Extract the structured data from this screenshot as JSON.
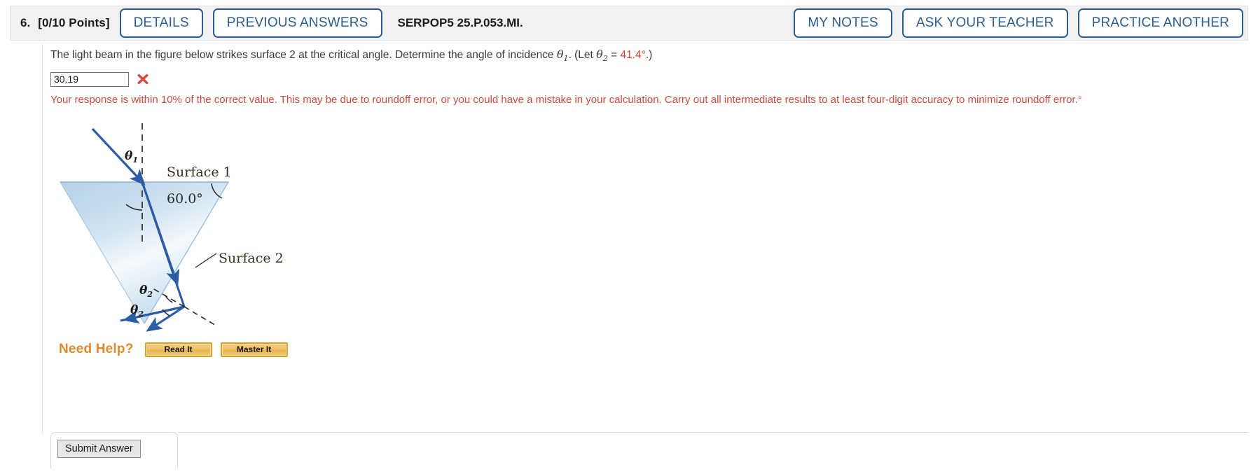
{
  "header": {
    "question_number": "6.",
    "points": "[0/10 Points]",
    "details_label": "DETAILS",
    "previous_answers_label": "PREVIOUS ANSWERS",
    "question_code": "SERPOP5 25.P.053.MI.",
    "my_notes_label": "MY NOTES",
    "ask_teacher_label": "ASK YOUR TEACHER",
    "practice_another_label": "PRACTICE ANOTHER",
    "accent_color": "#2c5d91",
    "bar_color": "#f1f1f1"
  },
  "question": {
    "text_part1": "The light beam in the figure below strikes surface 2 at the critical angle. Determine the angle of incidence ",
    "theta1_symbol": "θ",
    "theta1_sub": "1",
    "text_part2": ". (Let ",
    "theta2_symbol": "θ",
    "theta2_sub": "2",
    "equals": " = ",
    "theta2_value": "41.4°",
    "text_part3": ".)"
  },
  "answer": {
    "value": "30.19",
    "placeholder": "",
    "status_icon": "x-mark-incorrect",
    "status_color": "#d4473c"
  },
  "feedback": {
    "line1": "Your response is within 10% of the correct value. This may be due to roundoff error, or you could have a mistake in your calculation. Carry out all intermediate results to at least four-digit accuracy to",
    "line2": "minimize roundoff error.",
    "unit": "°",
    "color": "#cd4a3e"
  },
  "figure": {
    "alt": "Light beam entering an inverted triangular prism, refracting at surface 1 and totally internally reflecting at surface 2",
    "labels": {
      "theta1": "θ",
      "theta1_sub": "1",
      "surface1": "Surface 1",
      "apex_angle": "60.0°",
      "surface2": "Surface 2",
      "theta2_a": "θ",
      "theta2_a_sub": "2",
      "theta2_b": "θ",
      "theta2_b_sub": "2"
    },
    "ray_color": "#2c5ca6",
    "prism_fill_top": "#bdd6ea",
    "prism_fill_mid": "#f3f8fc"
  },
  "need_help": {
    "label": "Need Help?",
    "read_it_label": "Read It",
    "master_it_label": "Master It",
    "label_color": "#e08a2e",
    "button_color": "#e9b449"
  },
  "submit": {
    "label": "Submit Answer"
  }
}
